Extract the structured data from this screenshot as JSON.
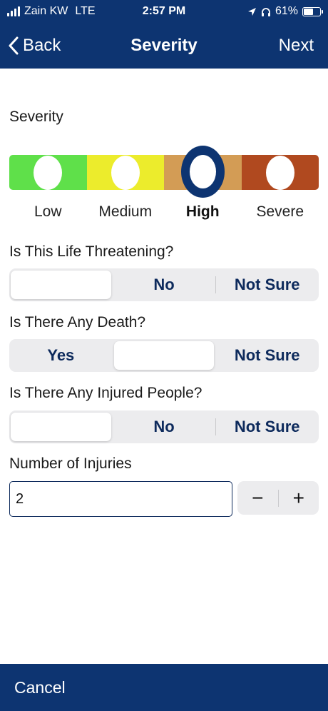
{
  "status_bar": {
    "carrier": "Zain KW",
    "network": "LTE",
    "time": "2:57 PM",
    "battery": "61%",
    "battery_level": 0.61
  },
  "nav": {
    "back_label": "Back",
    "title": "Severity",
    "next_label": "Next"
  },
  "severity": {
    "label": "Severity",
    "levels": [
      "Low",
      "Medium",
      "High",
      "Severe"
    ],
    "selected": "High",
    "colors": [
      "#5fe04a",
      "#ecec2c",
      "#d39c55",
      "#b0491f"
    ]
  },
  "life_threatening": {
    "question": "Is This Life Threatening?",
    "options": [
      "",
      "No",
      "Not Sure"
    ]
  },
  "death": {
    "question": "Is There Any Death?",
    "options": [
      "Yes",
      "",
      "Not Sure"
    ]
  },
  "injured": {
    "question": "Is There Any Injured People?",
    "options": [
      "",
      "No",
      "Not Sure"
    ]
  },
  "injuries": {
    "label": "Number of Injuries",
    "value": "2",
    "minus": "−",
    "plus": "+"
  },
  "footer": {
    "cancel_label": "Cancel"
  },
  "theme": {
    "primary": "#0d3471"
  }
}
